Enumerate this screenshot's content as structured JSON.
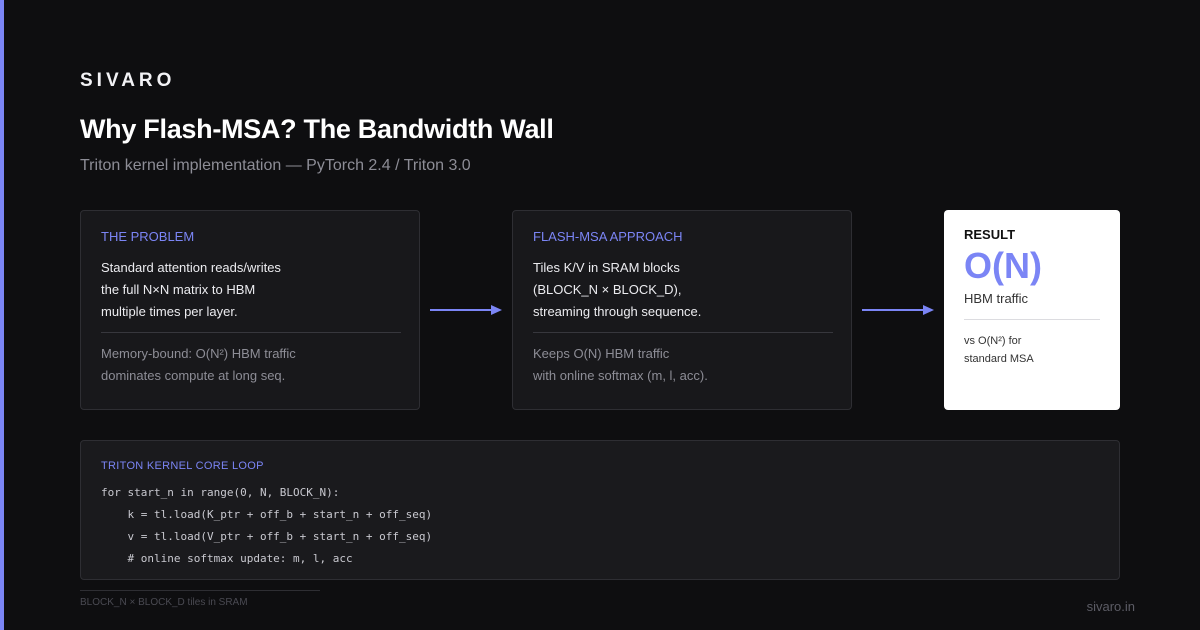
{
  "brand": "SIVARO",
  "title": "Why Flash-MSA? The Bandwidth Wall",
  "subtitle": "Triton kernel implementation — PyTorch 2.4 / Triton 3.0",
  "problem": {
    "label": "THE PROBLEM",
    "body": [
      "Standard attention reads/writes",
      "the full N×N matrix to HBM",
      "multiple times per layer."
    ],
    "note": [
      "Memory-bound: O(N²) HBM traffic",
      "dominates compute at long seq."
    ]
  },
  "approach": {
    "label": "FLASH-MSA APPROACH",
    "body": [
      "Tiles K/V in SRAM blocks",
      "(BLOCK_N × BLOCK_D),",
      "streaming through sequence."
    ],
    "note": [
      "Keeps O(N) HBM traffic",
      "with online softmax (m, l, acc)."
    ]
  },
  "result": {
    "label": "RESULT",
    "value": "O(N)",
    "sub": "HBM traffic",
    "note": [
      "vs O(N²) for",
      "standard MSA"
    ]
  },
  "code": {
    "label": "TRITON KERNEL CORE LOOP",
    "lines": [
      "for start_n in range(0, N, BLOCK_N):",
      "    k = tl.load(K_ptr + off_b + start_n + off_seq)",
      "    v = tl.load(V_ptr + off_b + start_n + off_seq)",
      "    # online softmax update: m, l, acc"
    ]
  },
  "footer": {
    "note": "BLOCK_N × BLOCK_D tiles in SRAM",
    "url": "sivaro.in"
  },
  "colors": {
    "accent": "#7b85f5",
    "background": "#0e0e10",
    "card": "#18181b",
    "result_card": "#ffffff"
  }
}
